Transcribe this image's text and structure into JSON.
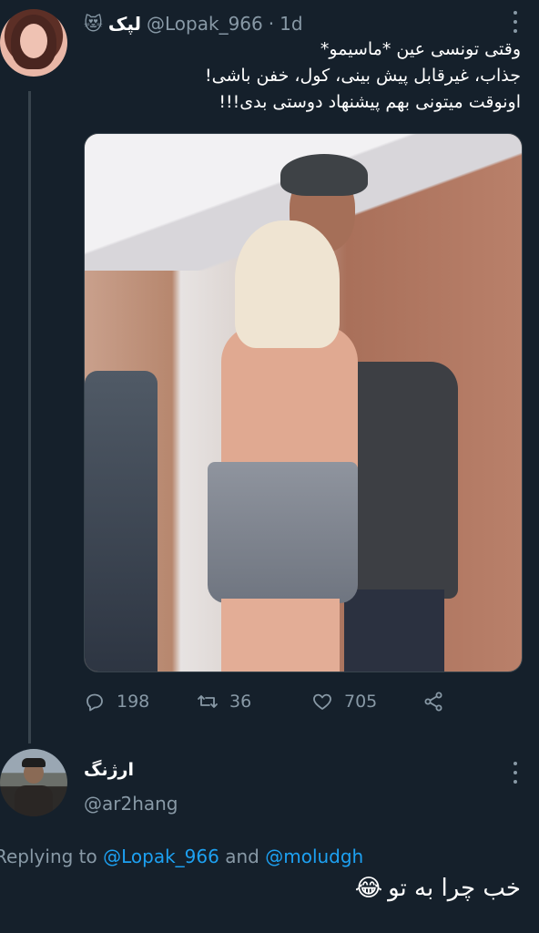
{
  "tweet": {
    "display_name": "لپک",
    "name_emoji": "😻",
    "handle": "@Lopak_966",
    "separator": "·",
    "time": "1d",
    "lines": [
      "وقتی تونسی عین *ماسیمو*",
      "جذاب، غیرقابل پیش بینی، کول، خفن باشی!",
      "اونوقت میتونی بهم پیشنهاد دوستی بدی!!!"
    ],
    "reply_count": "198",
    "retweet_count": "36",
    "like_count": "705"
  },
  "reply": {
    "display_name": "ارژنگ",
    "handle": "@ar2hang",
    "replying_prefix": "Replying to",
    "mention1": "@Lopak_966",
    "and_word": "and",
    "mention2": "@moludgh",
    "text": "خب چرا به تو",
    "emoji": "😂"
  },
  "colors": {
    "background": "#15202b",
    "secondary_text": "#8899a6",
    "link": "#1da1f2",
    "divider": "#38444d"
  },
  "icons": {
    "reply": "reply-icon",
    "retweet": "retweet-icon",
    "like": "heart-icon",
    "share": "share-icon",
    "more": "more-icon"
  }
}
